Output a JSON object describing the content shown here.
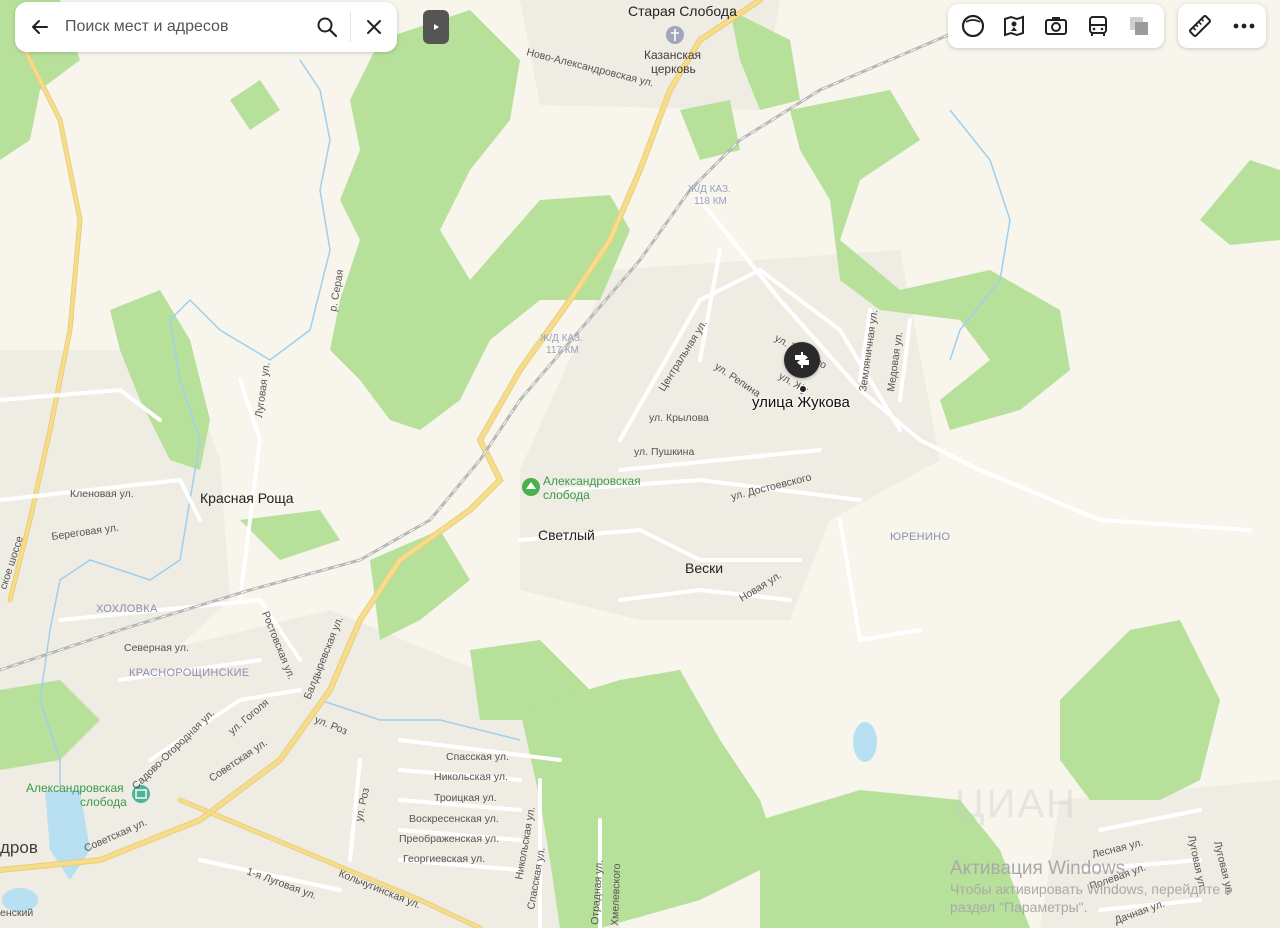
{
  "search": {
    "placeholder": "Поиск мест и адресов",
    "back_icon": "arrow-left-icon",
    "search_icon": "search-icon",
    "close_icon": "close-icon"
  },
  "toolbar": {
    "items": [
      {
        "name": "map-layer-icon"
      },
      {
        "name": "panorama-icon"
      },
      {
        "name": "photo-camera-icon"
      },
      {
        "name": "transport-bus-icon"
      },
      {
        "name": "layers-icon"
      }
    ],
    "extra": [
      {
        "name": "ruler-icon"
      },
      {
        "name": "more-icon"
      }
    ]
  },
  "marker": {
    "label": "улица Жукова",
    "icon": "street-sign-icon"
  },
  "places": {
    "staraya_sloboda": "Старая Слобода",
    "kazan_church_1": "Казанская",
    "kazan_church_2": "церковь",
    "krasnaya_roscha": "Красная Роща",
    "svetly": "Светлый",
    "veski": "Вески",
    "yurenino": "ЮРЕНИНО",
    "khokhlovka": "ХОХЛОВКА",
    "krasnoroshinskie": "КРАСНОРОЩИНСКИЕ",
    "city_partial": "дров",
    "alex_sloboda_1": "Александровская",
    "alex_sloboda_2": "слобода",
    "alex_sloboda_st_1": "Александровская",
    "alex_sloboda_st_2": "слобода",
    "bottom_left_partial": "енский"
  },
  "rail": {
    "km118_1": "Ж/Д КАЗ.",
    "km118_2": "118 КМ",
    "km117_1": "Ж/Д КАЗ.",
    "km117_2": "117 КМ"
  },
  "streets": {
    "novo_alex": "Ново-Александровская ул.",
    "river_seraya": "р. Серая",
    "lugovaya": "Луговая ул.",
    "klenovaya": "Кленовая ул.",
    "beregovaya": "Береговая ул.",
    "shosse": "ское шоссе",
    "severnaya": "Северная ул.",
    "rostovskaya": "Ростовская ул.",
    "baldzhirevskaya": "Балдыревская ул.",
    "sadovo": "Садово-Огородная ул.",
    "gogolya": "ул. Гоголя",
    "sovetskaya1": "Советская ул.",
    "sovetskaya2": "Советская ул.",
    "roz1": "ул. Роз",
    "roz2": "ул. Роз",
    "spasskaya": "Спасская ул.",
    "nikolskaya": "Никольская ул.",
    "troitskaya": "Троицкая ул.",
    "voskresenskaya": "Воскресенская ул.",
    "preobrazhenskaya": "Преображенская ул.",
    "georgievskaya": "Георгиевская ул.",
    "nikolskaya2": "Никольская ул.",
    "spasskaya2": "Спасская ул.",
    "otradnaya": "Отрадная ул.",
    "khmelevskogo": "Хмелевского",
    "lugovaya1": "1-я Луговая ул.",
    "kolchuginskaya": "Кольчугинская ул.",
    "tsentralnaya": "Центральная ул.",
    "repina": "ул. Репина",
    "krylova": "ул. Крылова",
    "pushkina": "ул. Пушкина",
    "dostoevskogo": "ул. Достоевского",
    "novaya": "Новая ул.",
    "zemlyanichnaya": "Земляничная ул.",
    "medovaya": "Медовая ул.",
    "zhukova_short": "ул. Жу",
    "tyutcheva": "ул. Тютчево",
    "lesnaya": "Лесная ул.",
    "polevaya": "Полевая ул.",
    "dachnaya": "Дачная ул.",
    "lugovaya_r1": "Луговая ул.",
    "lugovaya_r2": "Луговая ул."
  },
  "watermark": {
    "title": "Активация Windows",
    "line1": "Чтобы активировать Windows, перейдите в",
    "line2": "раздел \"Параметры\".",
    "ghost": "ЦИАН"
  },
  "colors": {
    "background": "#f7f5ec",
    "forest": "#b7e09a",
    "road_major": "#f7dd8b",
    "road_minor": "#ffffff",
    "water": "#b9dff3",
    "rail": "#a9a9a9",
    "marker": "#2a2a2a"
  }
}
